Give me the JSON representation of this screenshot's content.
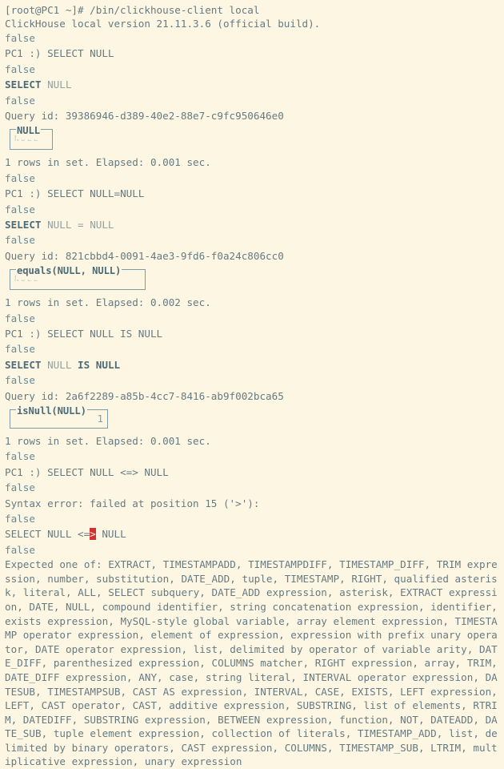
{
  "terminal": {
    "shell_prompt_line": "[root@PC1 ~]# /bin/clickhouse-client local",
    "version_line": "ClickHouse local version 21.11.3.6 (official build).",
    "client_prompt": "PC1 :) "
  },
  "sessions": [
    {
      "prompt_command": "SELECT NULL",
      "echo": [
        {
          "text": "SELECT",
          "style": "kw"
        },
        {
          "text": " ",
          "style": "plain"
        },
        {
          "text": "NULL",
          "style": "lit"
        }
      ],
      "query_id_label": "Query id: ",
      "query_id": "39386946-d389-40e2-88e7-c9fc950646e0",
      "result": {
        "header": "NULL",
        "value": "NULL",
        "value_kind": "null",
        "box": "box-null"
      },
      "stats": "1 rows in set. Elapsed: 0.001 sec."
    },
    {
      "prompt_command": "SELECT NULL=NULL",
      "echo": [
        {
          "text": "SELECT",
          "style": "kw"
        },
        {
          "text": " ",
          "style": "plain"
        },
        {
          "text": "NULL",
          "style": "lit"
        },
        {
          "text": " = ",
          "style": "lit"
        },
        {
          "text": "NULL",
          "style": "lit"
        }
      ],
      "query_id_label": "Query id: ",
      "query_id": "821cbbd4-0091-4ae3-9fd6-f0a24c806cc0",
      "result": {
        "header": "equals(NULL, NULL)",
        "value": "NULL",
        "value_kind": "null",
        "box": "box-equals"
      },
      "stats": "1 rows in set. Elapsed: 0.002 sec."
    },
    {
      "prompt_command": "SELECT NULL IS NULL",
      "echo": [
        {
          "text": "SELECT",
          "style": "kw"
        },
        {
          "text": " ",
          "style": "plain"
        },
        {
          "text": "NULL",
          "style": "lit"
        },
        {
          "text": " ",
          "style": "plain"
        },
        {
          "text": "IS NULL",
          "style": "kw"
        }
      ],
      "query_id_label": "Query id: ",
      "query_id": "2a6f2289-a85b-4cc7-8416-ab9f002bca65",
      "result": {
        "header": "isNull(NULL)",
        "value": "1",
        "value_kind": "number",
        "box": "box-isnull"
      },
      "stats": "1 rows in set. Elapsed: 0.001 sec."
    }
  ],
  "error_session": {
    "prompt_command": "SELECT NULL <=> NULL",
    "syntax_error": "Syntax error: failed at position 15 ('>'):",
    "failed_query_before": "SELECT NULL <=",
    "failed_query_cursor": ">",
    "failed_query_after": " NULL",
    "expected_text": "Expected one of: EXTRACT, TIMESTAMPADD, TIMESTAMPDIFF, TIMESTAMP_DIFF, TRIM expression, number, substitution, DATE_ADD, tuple, TIMESTAMP, RIGHT, qualified asterisk, literal, ALL, SELECT subquery, DATE_ADD expression, asterisk, EXTRACT expression, DATE, NULL, compound identifier, string concatenation expression, identifier, exists expression, MySQL-style global variable, array element expression, TIMESTAMP operator expression, element of expression, expression with prefix unary operator, DATE operator expression, list, delimited by operator of variable arity, DATE_DIFF, parenthesized expression, COLUMNS matcher, RIGHT expression, array, TRIM, DATE_DIFF expression, ANY, case, string literal, INTERVAL operator expression, DATESUB, TIMESTAMPSUB, CAST AS expression, INTERVAL, CASE, EXISTS, LEFT expression, LEFT, CAST operator, CAST, additive expression, SUBSTRING, list of elements, RTRIM, DATEDIFF, SUBSTRING expression, BETWEEN expression, function, NOT, DATEADD, DATE_SUB, tuple element expression, collection of literals, TIMESTAMP_ADD, list, delimited by binary operators, CAST expression, COLUMNS, TIMESTAMP_SUB, LTRIM, multiplicative expression, unary expression"
  },
  "colors": {
    "background": "#fdf6e3",
    "foreground": "#657b83",
    "keyword": "#4a6b78",
    "dim": "#93a1a1",
    "border": "#7f9ca6",
    "cursor_bg": "#d33033",
    "cursor_fg": "#fdf6e3"
  }
}
